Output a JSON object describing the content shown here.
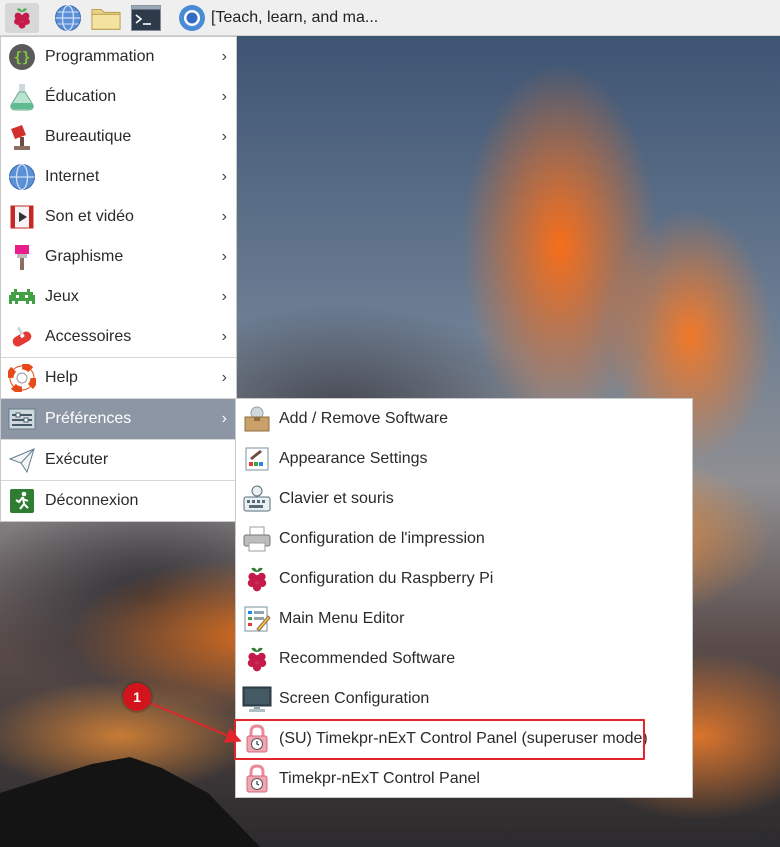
{
  "taskbar": {
    "window_title": "[Teach, learn, and ma..."
  },
  "menu": {
    "items": [
      {
        "label": "Programmation",
        "icon": "braces-icon"
      },
      {
        "label": "Éducation",
        "icon": "flask-icon"
      },
      {
        "label": "Bureautique",
        "icon": "office-icon"
      },
      {
        "label": "Internet",
        "icon": "globe-icon"
      },
      {
        "label": "Son et vidéo",
        "icon": "film-icon"
      },
      {
        "label": "Graphisme",
        "icon": "paintbrush-icon"
      },
      {
        "label": "Jeux",
        "icon": "invader-icon"
      },
      {
        "label": "Accessoires",
        "icon": "swiss-knife-icon"
      },
      {
        "label": "Help",
        "icon": "lifebuoy-icon"
      },
      {
        "label": "Préférences",
        "icon": "preferences-icon"
      },
      {
        "label": "Exécuter",
        "icon": "paper-plane-icon"
      },
      {
        "label": "Déconnexion",
        "icon": "exit-icon"
      }
    ]
  },
  "submenu": {
    "items": [
      {
        "label": "Add / Remove Software",
        "icon": "package-icon"
      },
      {
        "label": "Appearance Settings",
        "icon": "appearance-icon"
      },
      {
        "label": "Clavier et souris",
        "icon": "keyboard-mouse-icon"
      },
      {
        "label": "Configuration de l'impression",
        "icon": "printer-icon"
      },
      {
        "label": "Configuration du Raspberry Pi",
        "icon": "raspberry-icon"
      },
      {
        "label": "Main Menu Editor",
        "icon": "menu-editor-icon"
      },
      {
        "label": "Recommended Software",
        "icon": "raspberry-icon"
      },
      {
        "label": "Screen Configuration",
        "icon": "monitor-icon"
      },
      {
        "label": "(SU) Timekpr-nExT Control Panel (superuser mode)",
        "icon": "timekpr-lock-icon"
      },
      {
        "label": "Timekpr-nExT Control Panel",
        "icon": "timekpr-lock-icon"
      }
    ]
  },
  "annotation": {
    "badge": "1"
  },
  "colors": {
    "active_item_bg": "#8d96a5",
    "highlight": "#e2252b",
    "badge": "#d4141c"
  }
}
